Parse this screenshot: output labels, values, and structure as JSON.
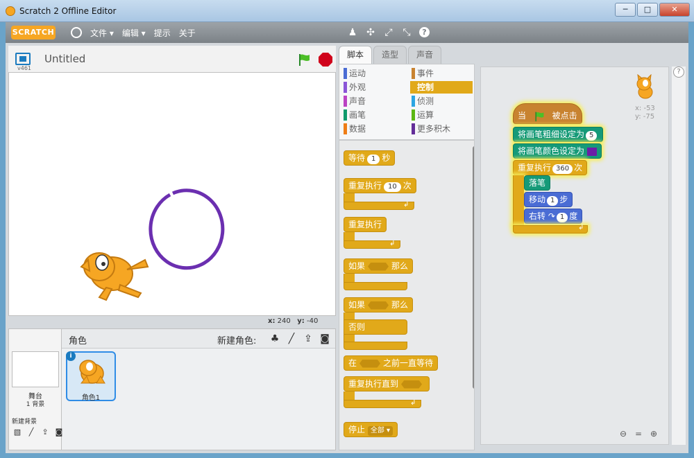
{
  "window": {
    "title": "Scratch 2 Offline Editor",
    "minimize": "─",
    "maximize": "□",
    "close": "✕"
  },
  "menubar": {
    "logo": "SCRATCH",
    "items": [
      "文件 ▾",
      "编辑 ▾",
      "提示",
      "关于"
    ],
    "tools": [
      {
        "name": "duplicate-icon",
        "glyph": "♟"
      },
      {
        "name": "cut-icon",
        "glyph": "✣"
      },
      {
        "name": "grow-icon",
        "glyph": "⤢"
      },
      {
        "name": "shrink-icon",
        "glyph": "⤡"
      },
      {
        "name": "help-icon",
        "glyph": "?"
      }
    ]
  },
  "stage": {
    "version": "v461",
    "project_title": "Untitled",
    "mouse_x_label": "x:",
    "mouse_x": "240",
    "mouse_y_label": "y:",
    "mouse_y": "-40"
  },
  "sprites_pane": {
    "title": "角色",
    "new_sprite_label": "新建角色:",
    "stage_label": "舞台",
    "stage_backdrops": "1 背景",
    "new_backdrop_label": "新建背景",
    "sprites": [
      {
        "name": "角色1",
        "info": "i"
      }
    ]
  },
  "tabs": [
    {
      "label": "脚本",
      "active": true
    },
    {
      "label": "造型",
      "active": false
    },
    {
      "label": "声音",
      "active": false
    }
  ],
  "categories": [
    {
      "label": "运动",
      "color": "#4a6cd4"
    },
    {
      "label": "事件",
      "color": "#c88330"
    },
    {
      "label": "外观",
      "color": "#8a55d7"
    },
    {
      "label": "控制",
      "color": "#e1a91a",
      "selected": true
    },
    {
      "label": "声音",
      "color": "#bb42c3"
    },
    {
      "label": "侦测",
      "color": "#2ca5e2"
    },
    {
      "label": "画笔",
      "color": "#0e9a6c"
    },
    {
      "label": "运算",
      "color": "#5cb712"
    },
    {
      "label": "数据",
      "color": "#ee7d16"
    },
    {
      "label": "更多积木",
      "color": "#632d99"
    }
  ],
  "palette_blocks": {
    "wait_pre": "等待",
    "wait_val": "1",
    "wait_post": "秒",
    "repeat_pre": "重复执行",
    "repeat_val": "10",
    "repeat_post": "次",
    "forever": "重复执行",
    "if_pre": "如果",
    "if_post": "那么",
    "ifelse_pre": "如果",
    "ifelse_post": "那么",
    "else": "否则",
    "waituntil_pre": "在",
    "waituntil_post": "之前一直等待",
    "repeatuntil": "重复执行直到",
    "stop": "停止",
    "stop_opt": "全部 ▾"
  },
  "script": {
    "hat_pre": "当",
    "hat_post": "被点击",
    "pen_size_label": "将画笔粗细设定为",
    "pen_size_value": "5",
    "pen_color_label": "将画笔颜色设定为",
    "pen_color": "#6b1fa6",
    "repeat_label": "重复执行",
    "repeat_value": "360",
    "repeat_post": "次",
    "pen_down": "落笔",
    "move_label": "移动",
    "move_value": "1",
    "move_post": "步",
    "turn_label": "右转",
    "turn_value": "1",
    "turn_post": "度"
  },
  "sprite_info": {
    "x": "x: -53",
    "y": "y: -75"
  },
  "zoom": [
    "⊖",
    "=",
    "⊕"
  ]
}
